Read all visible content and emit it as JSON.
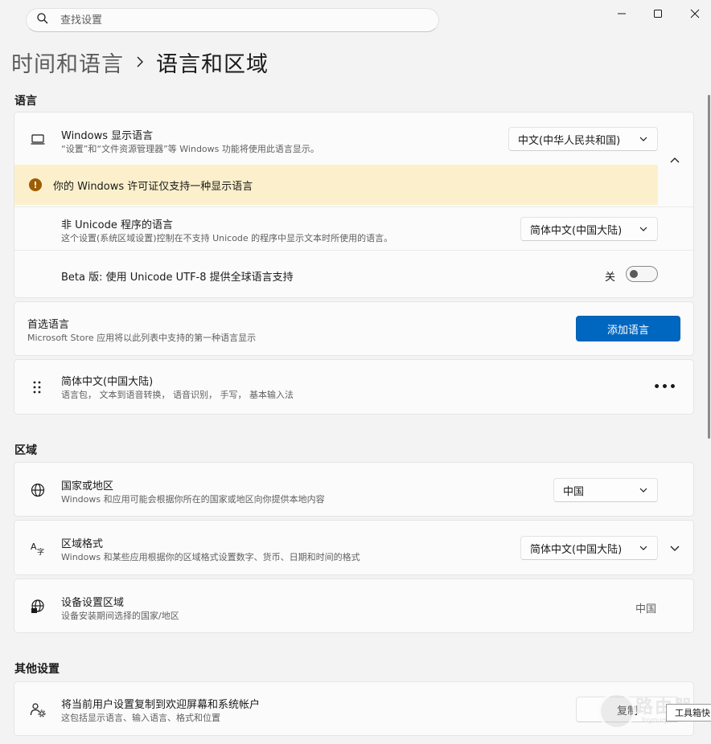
{
  "search": {
    "placeholder": "查找设置"
  },
  "window": {
    "minimize_icon": "minimize-icon",
    "maximize_icon": "maximize-icon",
    "close_icon": "close-icon"
  },
  "breadcrumb": {
    "parent": "时间和语言",
    "current": "语言和区域"
  },
  "sections": {
    "language": "语言",
    "region": "区域",
    "other": "其他设置"
  },
  "display_language": {
    "title": "Windows 显示语言",
    "desc": "“设置”和“文件资源管理器”等 Windows 功能将使用此语言显示。",
    "selected": "中文(中华人民共和国)",
    "warning": "你的 Windows 许可证仅支持一种显示语言",
    "non_unicode_title": "非 Unicode 程序的语言",
    "non_unicode_desc": "这个设置(系统区域设置)控制在不支持 Unicode 的程序中显示文本时所使用的语言。",
    "non_unicode_selected": "简体中文(中国大陆)",
    "beta_title": "Beta 版: 使用 Unicode UTF-8 提供全球语言支持",
    "beta_state": "关"
  },
  "preferred": {
    "title": "首选语言",
    "desc": "Microsoft Store 应用将以此列表中支持的第一种语言显示",
    "add_button": "添加语言"
  },
  "language_item": {
    "title": "简体中文(中国大陆)",
    "desc": "语言包， 文本到语音转换， 语音识别， 手写， 基本输入法",
    "more": "•••"
  },
  "country": {
    "title": "国家或地区",
    "desc": "Windows 和应用可能会根据你所在的国家或地区向你提供本地内容",
    "selected": "中国"
  },
  "format": {
    "title": "区域格式",
    "desc": "Windows 和某些应用根据你的区域格式设置数字、货币、日期和时间的格式",
    "selected": "简体中文(中国大陆)"
  },
  "device_region": {
    "title": "设备设置区域",
    "desc": "设备安装期间选择的国家/地区",
    "value": "中国"
  },
  "copy_settings": {
    "title": "将当前用户设置复制到欢迎屏幕和系统帐户",
    "desc": "这包括显示语言、输入语言、格式和位置",
    "button": "复制"
  },
  "overlay": {
    "watermark": "路由器",
    "watermark_sub": "luyouqi.com",
    "toolbox": "工具箱快"
  },
  "colors": {
    "accent": "#0067c0",
    "warning_bg": "#fcf0cc",
    "warning_icon": "#9d5d00"
  }
}
